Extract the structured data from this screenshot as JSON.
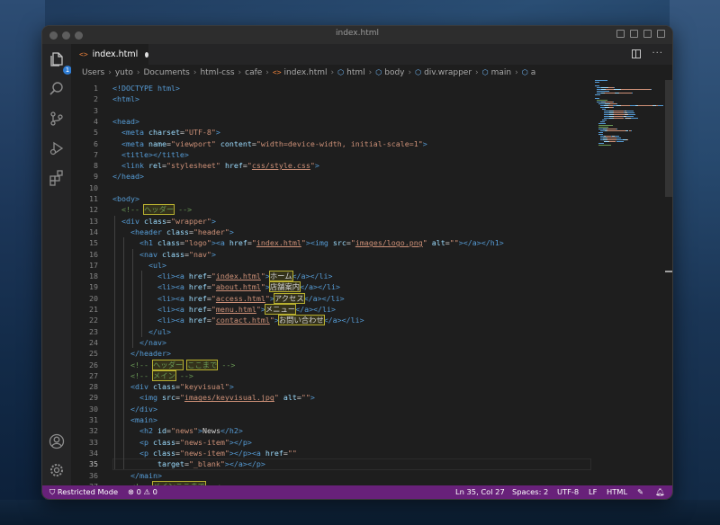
{
  "window": {
    "title": "index.html"
  },
  "tab": {
    "icon": "<>",
    "label": "index.html"
  },
  "activity": {
    "explorer_badge": "1"
  },
  "breadcrumbs": [
    "Users",
    "yuto",
    "Documents",
    "html-css",
    "cafe",
    "index.html",
    "html",
    "body",
    "div.wrapper",
    "main",
    "a"
  ],
  "statusbar": {
    "restricted": "Restricted Mode",
    "errors": "0",
    "warnings": "0",
    "position": "Ln 35, Col 27",
    "spaces": "Spaces: 2",
    "encoding": "UTF-8",
    "eol": "LF",
    "language": "HTML"
  },
  "editor": {
    "current_line": 35,
    "lines": [
      {
        "n": "1",
        "indent": 0,
        "seg": [
          [
            "t",
            "<!DOCTYPE html>"
          ]
        ]
      },
      {
        "n": "2",
        "indent": 0,
        "seg": [
          [
            "t",
            "<html>"
          ]
        ]
      },
      {
        "n": "3",
        "indent": 0,
        "seg": []
      },
      {
        "n": "4",
        "indent": 0,
        "seg": [
          [
            "t",
            "<head>"
          ]
        ]
      },
      {
        "n": "5",
        "indent": 1,
        "seg": [
          [
            "t",
            "<meta "
          ],
          [
            "a",
            "charset"
          ],
          [
            "d",
            "="
          ],
          [
            "s",
            "\"UTF-8\""
          ],
          [
            "t",
            ">"
          ]
        ]
      },
      {
        "n": "6",
        "indent": 1,
        "seg": [
          [
            "t",
            "<meta "
          ],
          [
            "a",
            "name"
          ],
          [
            "d",
            "="
          ],
          [
            "s",
            "\"viewport\""
          ],
          [
            "d",
            " "
          ],
          [
            "a",
            "content"
          ],
          [
            "d",
            "="
          ],
          [
            "s",
            "\"width=device-width, initial-scale=1\""
          ],
          [
            "t",
            ">"
          ]
        ]
      },
      {
        "n": "7",
        "indent": 1,
        "seg": [
          [
            "t",
            "<title></title>"
          ]
        ]
      },
      {
        "n": "8",
        "indent": 1,
        "seg": [
          [
            "t",
            "<link "
          ],
          [
            "a",
            "rel"
          ],
          [
            "d",
            "="
          ],
          [
            "s",
            "\"stylesheet\""
          ],
          [
            "d",
            " "
          ],
          [
            "a",
            "href"
          ],
          [
            "d",
            "="
          ],
          [
            "s",
            "\""
          ],
          [
            "su",
            "css/style.css"
          ],
          [
            "s",
            "\""
          ],
          [
            "t",
            ">"
          ]
        ]
      },
      {
        "n": "9",
        "indent": 0,
        "seg": [
          [
            "t",
            "</head>"
          ]
        ]
      },
      {
        "n": "10",
        "indent": 0,
        "seg": []
      },
      {
        "n": "11",
        "indent": 0,
        "seg": [
          [
            "t",
            "<body>"
          ]
        ]
      },
      {
        "n": "12",
        "indent": 1,
        "seg": [
          [
            "c",
            "<!-- "
          ],
          [
            "cj",
            "ヘッダー"
          ],
          [
            "c",
            " -->"
          ]
        ]
      },
      {
        "n": "13",
        "indent": 1,
        "seg": [
          [
            "t",
            "<div "
          ],
          [
            "a",
            "class"
          ],
          [
            "d",
            "="
          ],
          [
            "s",
            "\"wrapper\""
          ],
          [
            "t",
            ">"
          ]
        ]
      },
      {
        "n": "14",
        "indent": 2,
        "seg": [
          [
            "t",
            "<header "
          ],
          [
            "a",
            "class"
          ],
          [
            "d",
            "="
          ],
          [
            "s",
            "\"header\""
          ],
          [
            "t",
            ">"
          ]
        ]
      },
      {
        "n": "15",
        "indent": 3,
        "seg": [
          [
            "t",
            "<h1 "
          ],
          [
            "a",
            "class"
          ],
          [
            "d",
            "="
          ],
          [
            "s",
            "\"logo\""
          ],
          [
            "t",
            "><a "
          ],
          [
            "a",
            "href"
          ],
          [
            "d",
            "="
          ],
          [
            "s",
            "\""
          ],
          [
            "su",
            "index.html"
          ],
          [
            "s",
            "\""
          ],
          [
            "t",
            "><img "
          ],
          [
            "a",
            "src"
          ],
          [
            "d",
            "="
          ],
          [
            "s",
            "\""
          ],
          [
            "su",
            "images/logo.png"
          ],
          [
            "s",
            "\""
          ],
          [
            "d",
            " "
          ],
          [
            "a",
            "alt"
          ],
          [
            "d",
            "="
          ],
          [
            "s",
            "\"\""
          ],
          [
            "t",
            "></a></h1>"
          ]
        ]
      },
      {
        "n": "16",
        "indent": 3,
        "seg": [
          [
            "t",
            "<nav "
          ],
          [
            "a",
            "class"
          ],
          [
            "d",
            "="
          ],
          [
            "s",
            "\"nav\""
          ],
          [
            "t",
            ">"
          ]
        ]
      },
      {
        "n": "17",
        "indent": 4,
        "seg": [
          [
            "t",
            "<ul>"
          ]
        ]
      },
      {
        "n": "18",
        "indent": 5,
        "seg": [
          [
            "t",
            "<li><a "
          ],
          [
            "a",
            "href"
          ],
          [
            "d",
            "="
          ],
          [
            "s",
            "\""
          ],
          [
            "su",
            "index.html"
          ],
          [
            "s",
            "\""
          ],
          [
            "t",
            ">"
          ],
          [
            "dj",
            "ホーム"
          ],
          [
            "t",
            "</a></li>"
          ]
        ]
      },
      {
        "n": "19",
        "indent": 5,
        "seg": [
          [
            "t",
            "<li><a "
          ],
          [
            "a",
            "href"
          ],
          [
            "d",
            "="
          ],
          [
            "s",
            "\""
          ],
          [
            "su",
            "about.html"
          ],
          [
            "s",
            "\""
          ],
          [
            "t",
            ">"
          ],
          [
            "dj",
            "店舗案内"
          ],
          [
            "t",
            "</a></li>"
          ]
        ]
      },
      {
        "n": "20",
        "indent": 5,
        "seg": [
          [
            "t",
            "<li><a "
          ],
          [
            "a",
            "href"
          ],
          [
            "d",
            "="
          ],
          [
            "s",
            "\""
          ],
          [
            "su",
            "access.html"
          ],
          [
            "s",
            "\""
          ],
          [
            "t",
            ">"
          ],
          [
            "dj",
            "アクセス"
          ],
          [
            "t",
            "</a></li>"
          ]
        ]
      },
      {
        "n": "21",
        "indent": 5,
        "seg": [
          [
            "t",
            "<li><a "
          ],
          [
            "a",
            "href"
          ],
          [
            "d",
            "="
          ],
          [
            "s",
            "\""
          ],
          [
            "su",
            "menu.html"
          ],
          [
            "s",
            "\""
          ],
          [
            "t",
            ">"
          ],
          [
            "dj",
            "メニュー"
          ],
          [
            "t",
            "</a></li>"
          ]
        ]
      },
      {
        "n": "22",
        "indent": 5,
        "seg": [
          [
            "t",
            "<li><a "
          ],
          [
            "a",
            "href"
          ],
          [
            "d",
            "="
          ],
          [
            "s",
            "\""
          ],
          [
            "su",
            "contact.html"
          ],
          [
            "s",
            "\""
          ],
          [
            "t",
            ">"
          ],
          [
            "dj",
            "お問い合わせ"
          ],
          [
            "t",
            "</a></li>"
          ]
        ]
      },
      {
        "n": "23",
        "indent": 4,
        "seg": [
          [
            "t",
            "</ul>"
          ]
        ]
      },
      {
        "n": "24",
        "indent": 3,
        "seg": [
          [
            "t",
            "</nav>"
          ]
        ]
      },
      {
        "n": "25",
        "indent": 2,
        "seg": [
          [
            "t",
            "</header>"
          ]
        ]
      },
      {
        "n": "26",
        "indent": 2,
        "seg": [
          [
            "c",
            "<!-- "
          ],
          [
            "cj",
            "ヘッダー"
          ],
          [
            "c",
            " "
          ],
          [
            "cj",
            "ここまで"
          ],
          [
            "c",
            " -->"
          ]
        ]
      },
      {
        "n": "27",
        "indent": 2,
        "seg": [
          [
            "c",
            "<!-- "
          ],
          [
            "cj",
            "メイン"
          ],
          [
            "c",
            " -->"
          ]
        ]
      },
      {
        "n": "28",
        "indent": 2,
        "seg": [
          [
            "t",
            "<div "
          ],
          [
            "a",
            "class"
          ],
          [
            "d",
            "="
          ],
          [
            "s",
            "\"keyvisual\""
          ],
          [
            "t",
            ">"
          ]
        ]
      },
      {
        "n": "29",
        "indent": 3,
        "seg": [
          [
            "t",
            "<img "
          ],
          [
            "a",
            "src"
          ],
          [
            "d",
            "="
          ],
          [
            "s",
            "\""
          ],
          [
            "su",
            "images/keyvisual.jpg"
          ],
          [
            "s",
            "\""
          ],
          [
            "d",
            " "
          ],
          [
            "a",
            "alt"
          ],
          [
            "d",
            "="
          ],
          [
            "s",
            "\"\""
          ],
          [
            "t",
            ">"
          ]
        ]
      },
      {
        "n": "30",
        "indent": 2,
        "seg": [
          [
            "t",
            "</div>"
          ]
        ]
      },
      {
        "n": "31",
        "indent": 2,
        "seg": [
          [
            "t",
            "<main>"
          ]
        ]
      },
      {
        "n": "32",
        "indent": 3,
        "seg": [
          [
            "t",
            "<h2 "
          ],
          [
            "a",
            "id"
          ],
          [
            "d",
            "="
          ],
          [
            "s",
            "\"news\""
          ],
          [
            "t",
            ">"
          ],
          [
            "d",
            "News"
          ],
          [
            "t",
            "</h2>"
          ]
        ]
      },
      {
        "n": "33",
        "indent": 3,
        "seg": [
          [
            "t",
            "<p "
          ],
          [
            "a",
            "class"
          ],
          [
            "d",
            "="
          ],
          [
            "s",
            "\"news-item\""
          ],
          [
            "t",
            "></p>"
          ]
        ]
      },
      {
        "n": "34",
        "indent": 3,
        "seg": [
          [
            "t",
            "<p "
          ],
          [
            "a",
            "class"
          ],
          [
            "d",
            "="
          ],
          [
            "s",
            "\"news-item\""
          ],
          [
            "t",
            "></p><a "
          ],
          [
            "a",
            "href"
          ],
          [
            "d",
            "="
          ],
          [
            "s",
            "\"\""
          ]
        ]
      },
      {
        "n": "35",
        "indent": 5,
        "seg": [
          [
            "a",
            "target"
          ],
          [
            "d",
            "="
          ],
          [
            "s",
            "\"_blank\""
          ],
          [
            "t",
            "></a></p>"
          ]
        ]
      },
      {
        "n": "36",
        "indent": 2,
        "seg": [
          [
            "t",
            "</main>"
          ]
        ]
      },
      {
        "n": "37",
        "indent": 2,
        "seg": [
          [
            "c",
            "<!-- "
          ],
          [
            "cj",
            "メインここまで"
          ],
          [
            "c",
            " -->"
          ]
        ]
      }
    ]
  }
}
